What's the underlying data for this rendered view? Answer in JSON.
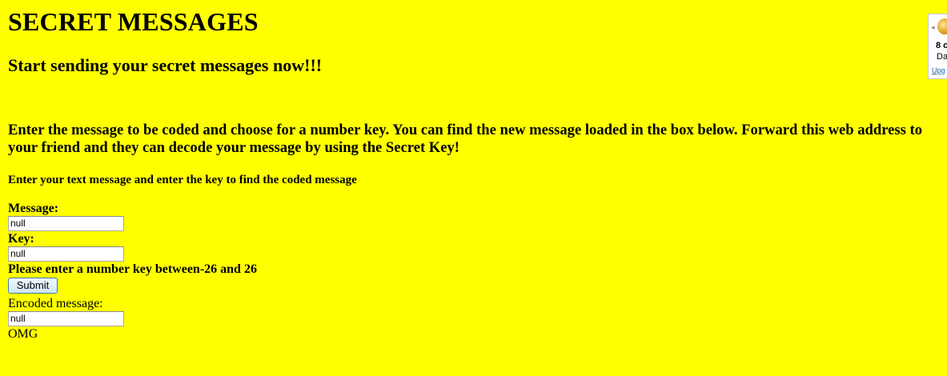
{
  "page": {
    "title": "SECRET MESSAGES",
    "subtitle": "Start sending your secret messages now!!!",
    "intro": "Enter the message to be coded and choose for a number key. You can find the new message loaded in the box below. Forward this web address to your friend and they can decode your message by using the Secret Key!",
    "subheading": "Enter your text message and enter the key to find the coded message"
  },
  "form": {
    "message_label": "Message:",
    "message_value": "null",
    "key_label": "Key:",
    "key_value": "null",
    "key_hint": "Please enter a number key between-26 and 26",
    "submit_label": "Submit",
    "encoded_label": "Encoded message:",
    "encoded_value": "null",
    "result_text": "OMG"
  },
  "ad": {
    "icon": "app-logo-icon",
    "arrow": "◂",
    "line1": "8 c",
    "line2": "Da",
    "line3": "Upg"
  },
  "colors": {
    "background": "#ffff00",
    "button_border": "#3c7fb1"
  }
}
